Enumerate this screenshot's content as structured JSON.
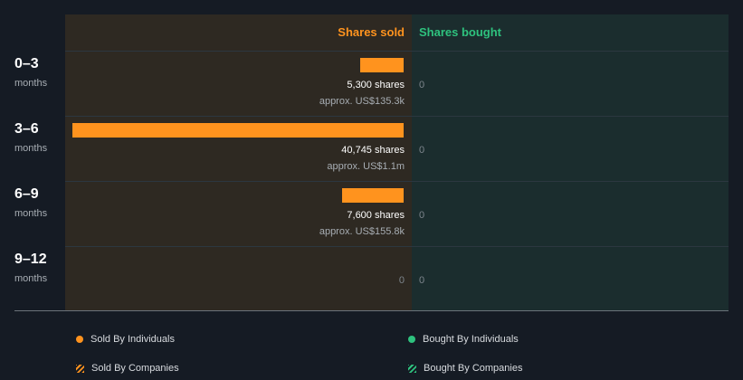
{
  "colors": {
    "sold": "#ff931e",
    "bought": "#2ec27e",
    "sold_bg": "#2e2922",
    "bought_bg": "#1b2d2e"
  },
  "headers": {
    "sold": "Shares sold",
    "bought": "Shares bought"
  },
  "chart_data": {
    "type": "bar",
    "categories": [
      "0–3",
      "3–6",
      "6–9",
      "9–12"
    ],
    "category_units": "months",
    "series": [
      {
        "name": "Shares sold",
        "values": [
          5300,
          40745,
          7600,
          0
        ],
        "value_labels": [
          "5,300 shares",
          "40,745 shares",
          "7,600 shares",
          "0"
        ],
        "approx_labels": [
          "approx. US$135.3k",
          "approx. US$1.1m",
          "approx. US$155.8k",
          ""
        ]
      },
      {
        "name": "Shares bought",
        "values": [
          0,
          0,
          0,
          0
        ],
        "value_labels": [
          "0",
          "0",
          "0",
          "0"
        ]
      }
    ]
  },
  "legend": {
    "sold_individuals": "Sold By Individuals",
    "bought_individuals": "Bought By Individuals",
    "sold_companies": "Sold By Companies",
    "bought_companies": "Bought By Companies"
  }
}
